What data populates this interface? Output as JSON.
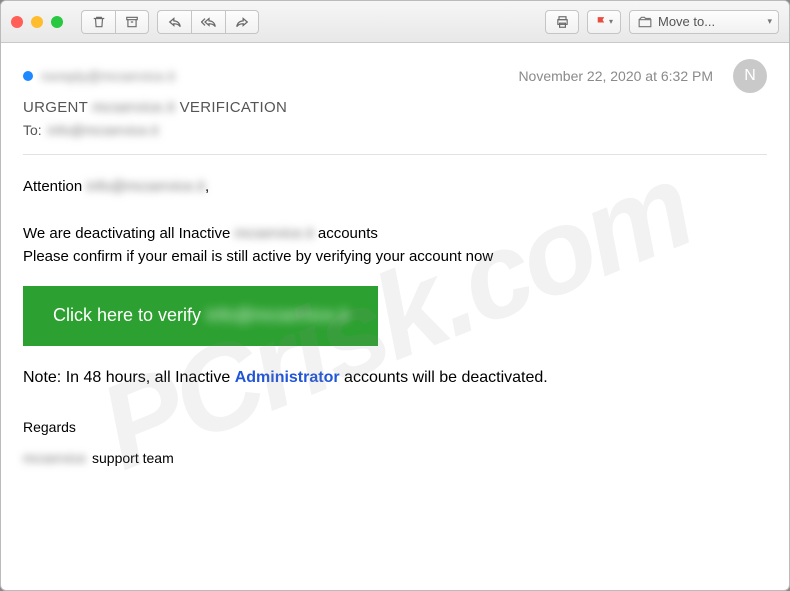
{
  "titlebar": {
    "moveto_label": "Move to..."
  },
  "header": {
    "from_redacted": "noreply@mcservice.it",
    "date": "November 22, 2020 at 6:32 PM",
    "avatar_initial": "N",
    "subject_prefix": "URGENT",
    "subject_redacted": "mcservice.it",
    "subject_suffix": "VERIFICATION",
    "to_label": "To:",
    "to_redacted": "info@mcservice.it"
  },
  "body": {
    "attention_label": "Attention",
    "attention_redacted": "info@mcservice.it",
    "attention_comma": ",",
    "line1_a": "We are deactivating all Inactive",
    "line1_redacted": "mcservice.it",
    "line1_b": "accounts",
    "line2": "Please confirm if your email is still active by verifying your account now",
    "verify_btn_text": "Click here to verify",
    "verify_btn_redacted": "info@mcservice.it",
    "note_a": "Note: In 48 hours, all Inactive",
    "note_admin": "Administrator",
    "note_b": "accounts will be deactivated.",
    "regards": "Regards",
    "support_redacted": "mcservice",
    "support_text": "support team"
  },
  "watermark": "PCrisk.com"
}
